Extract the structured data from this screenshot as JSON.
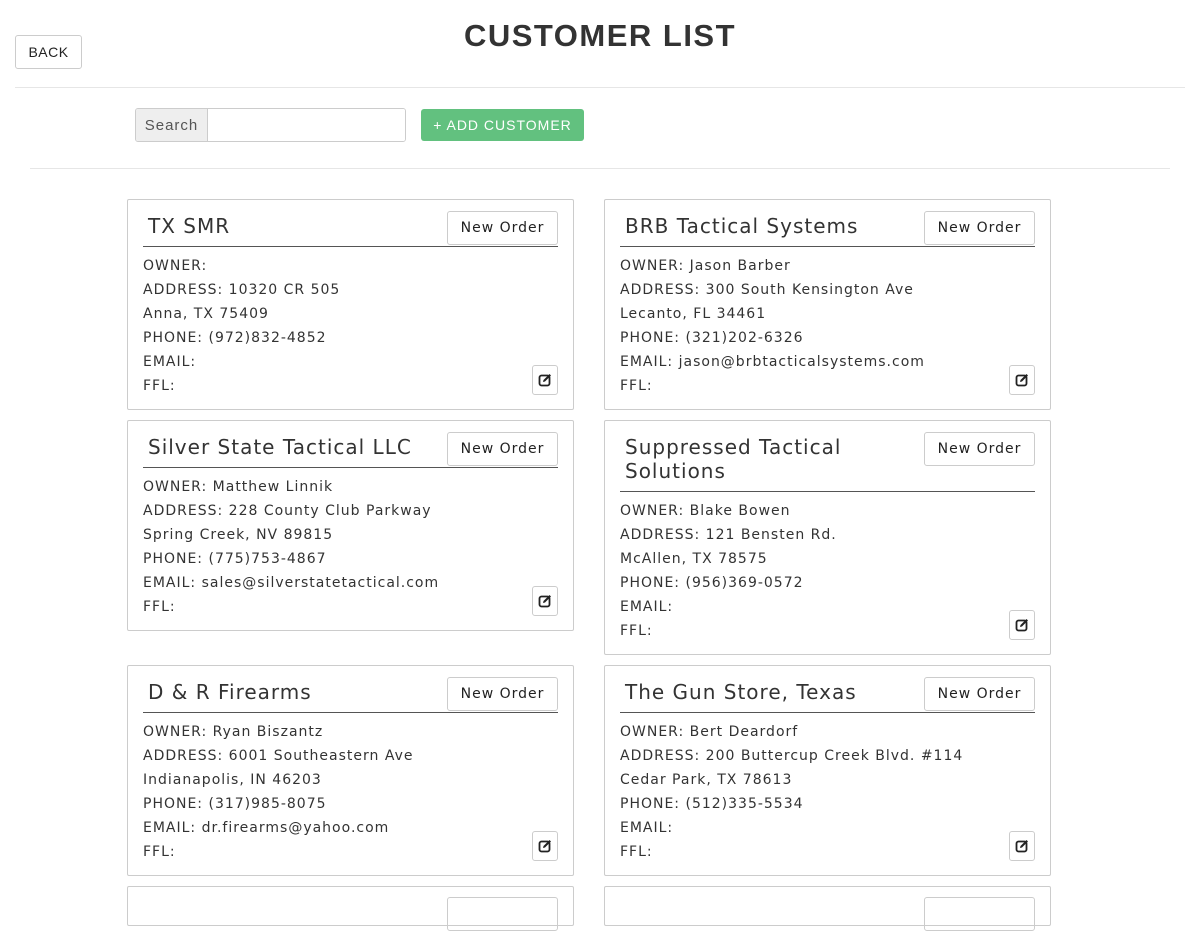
{
  "header": {
    "back_label": "BACK",
    "title": "CUSTOMER LIST"
  },
  "toolbar": {
    "search_label": "Search",
    "search_value": "",
    "add_customer_label": "+ ADD CUSTOMER"
  },
  "labels": {
    "owner": "OWNER:",
    "address": "ADDRESS:",
    "phone": "PHONE:",
    "email": "EMAIL:",
    "ffl": "FFL:",
    "new_order": "New Order"
  },
  "customers": [
    {
      "name": "TX SMR",
      "owner": "",
      "address1": "10320 CR 505",
      "address2": "Anna, TX 75409",
      "phone": "(972)832-4852",
      "email": "",
      "ffl": ""
    },
    {
      "name": "BRB Tactical Systems",
      "owner": "Jason Barber",
      "address1": "300 South Kensington Ave",
      "address2": "Lecanto, FL 34461",
      "phone": "(321)202-6326",
      "email": "jason@brbtacticalsystems.com",
      "ffl": ""
    },
    {
      "name": "Silver State Tactical LLC",
      "owner": "Matthew Linnik",
      "address1": "228 County Club Parkway",
      "address2": "Spring Creek, NV 89815",
      "phone": "(775)753-4867",
      "email": "sales@silverstatetactical.com",
      "ffl": ""
    },
    {
      "name": "Suppressed Tactical Solutions",
      "owner": "Blake Bowen",
      "address1": "121 Bensten Rd.",
      "address2": "McAllen, TX 78575",
      "phone": "(956)369-0572",
      "email": "",
      "ffl": ""
    },
    {
      "name": "D & R Firearms",
      "owner": "Ryan Biszantz",
      "address1": "6001 Southeastern Ave",
      "address2": "Indianapolis, IN 46203",
      "phone": "(317)985-8075",
      "email": "dr.firearms@yahoo.com",
      "ffl": ""
    },
    {
      "name": "The Gun Store, Texas",
      "owner": "Bert Deardorf",
      "address1": "200 Buttercup Creek Blvd. #114",
      "address2": "Cedar Park, TX 78613",
      "phone": "(512)335-5534",
      "email": "",
      "ffl": ""
    }
  ]
}
